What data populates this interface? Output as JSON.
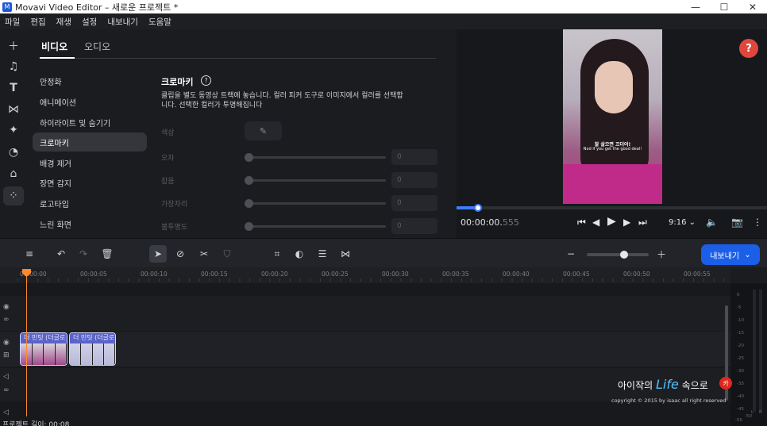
{
  "window": {
    "title": "Movavi Video Editor – 새로운 프로젝트 *",
    "app_icon": "M"
  },
  "menu": [
    "파일",
    "편집",
    "재생",
    "설정",
    "내보내기",
    "도움말"
  ],
  "panel": {
    "tabs": [
      "비디오",
      "오디오"
    ],
    "effects": [
      "안정화",
      "애니메이션",
      "하이라이트 및 숨기기",
      "크로마키",
      "배경 제거",
      "장면 감지",
      "로고타입",
      "느린 화면"
    ],
    "active_effect": "크로마키",
    "chroma": {
      "title": "크로마키",
      "description": "클립을 별도 동영상 트랙에 놓습니다. 컬러 피커 도구로 이미지에서 컬러를 선택합니다. 선택한 컬러가 투명해집니다",
      "params": [
        {
          "label": "색상"
        },
        {
          "label": "오차",
          "value": "0"
        },
        {
          "label": "잡음",
          "value": "0"
        },
        {
          "label": "가장자리",
          "value": "0"
        },
        {
          "label": "불투명도",
          "value": "0"
        }
      ]
    }
  },
  "preview": {
    "subtitle_ko": "잘 살으면 끄더어!",
    "subtitle_en": "Nod if you get the good deal!",
    "timecode_main": "00:00:00.",
    "timecode_ms": "555",
    "aspect": "9:16",
    "scrub_fraction": 0.07
  },
  "timeline": {
    "ruler": [
      "00:00:00",
      "00:00:05",
      "00:00:10",
      "00:00:15",
      "00:00:20",
      "00:00:25",
      "00:00:30",
      "00:00:35",
      "00:00:40",
      "00:00:45",
      "00:00:50",
      "00:00:55"
    ],
    "clips": [
      {
        "label": "더 민팃 (더글로"
      },
      {
        "label": "더 민팃 (더글로"
      }
    ],
    "export_label": "내보내기",
    "zoom_fraction": 0.6
  },
  "meter": {
    "labels": [
      "0",
      "-5",
      "-10",
      "-15",
      "-20",
      "-25",
      "-30",
      "-35",
      "-40",
      "-45",
      "-50",
      "-55"
    ],
    "channels": [
      "L",
      "R"
    ]
  },
  "status": "프로젝트 길이: 00:08",
  "watermark": {
    "pre": "아이작의 ",
    "life": "Life",
    "post": " 속으로",
    "copy": "copyright © 2015 by isaac all right reserved",
    "badge": "카"
  },
  "colors": {
    "accent": "#1b5ee8",
    "playhead": "#ff8a2b",
    "help": "#e0473c"
  }
}
